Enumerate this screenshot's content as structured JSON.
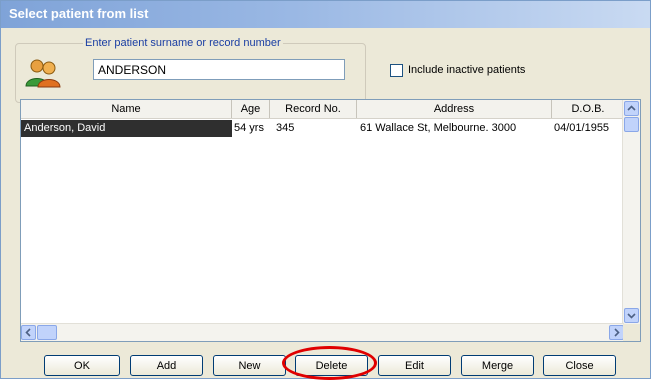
{
  "window": {
    "title": "Select patient from list"
  },
  "search": {
    "legend": "Enter patient surname or record number",
    "value": "ANDERSON"
  },
  "include_inactive": {
    "label": "Include inactive patients",
    "checked": false
  },
  "table": {
    "columns": [
      "Name",
      "Age",
      "Record No.",
      "Address",
      "D.O.B."
    ],
    "rows": [
      {
        "name": "Anderson, David",
        "age": "54 yrs",
        "record": "345",
        "address": "61 Wallace St, Melbourne. 3000",
        "dob": "04/01/1955",
        "selected": true
      }
    ]
  },
  "buttons": {
    "ok": "OK",
    "add": "Add",
    "new": "New",
    "delete": "Delete",
    "edit": "Edit",
    "merge": "Merge",
    "close": "Close"
  },
  "colors": {
    "title_bar": "#7fa3d8",
    "selected_row": "#2f2f2f",
    "highlight_ring": "#e00000"
  },
  "icons": {
    "search_group": "patients-people-icon"
  }
}
